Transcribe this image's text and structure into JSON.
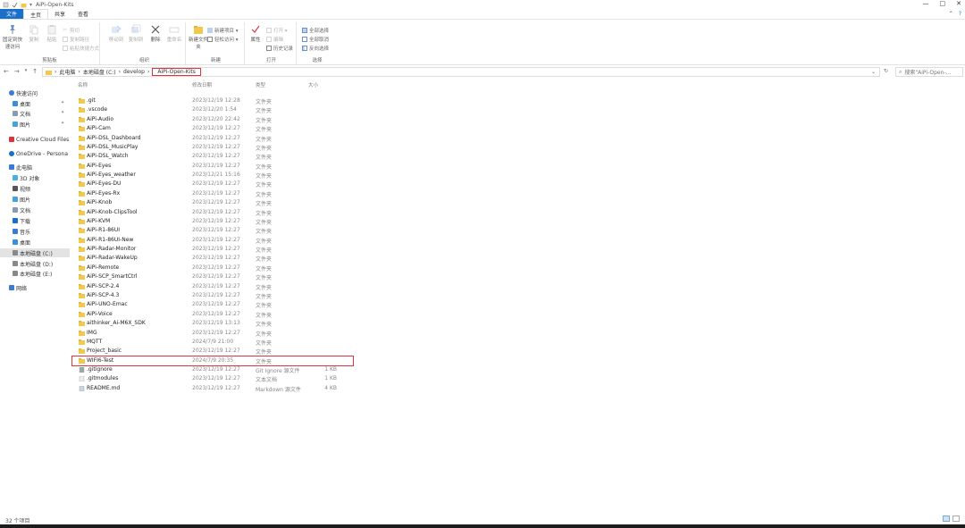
{
  "window": {
    "title": "AiPi-Open-Kits",
    "controls": [
      "—",
      "□",
      "✕"
    ]
  },
  "ribbon_tabs": [
    {
      "label": "文件"
    },
    {
      "label": "主页"
    },
    {
      "label": "共享"
    },
    {
      "label": "查看"
    }
  ],
  "ribbon": {
    "clipboard": {
      "group_label": "剪贴板",
      "pin_label": "固定到快速访问",
      "copy_label": "复制",
      "paste_label": "粘贴",
      "cut_label": "剪切",
      "copy_path_label": "复制路径",
      "paste_shortcut_label": "粘贴快捷方式"
    },
    "organize": {
      "group_label": "组织",
      "move_to_label": "移动到",
      "copy_to_label": "复制到",
      "delete_label": "删除",
      "rename_label": "重命名"
    },
    "new": {
      "group_label": "新建",
      "new_folder_label": "新建文件夹",
      "new_item_label": "新建项目 ▾",
      "easy_access_label": "轻松访问 ▾"
    },
    "open": {
      "group_label": "打开",
      "properties_label": "属性",
      "open_label": "打开 ▾",
      "edit_label": "编辑",
      "history_label": "历史记录"
    },
    "select": {
      "group_label": "选择",
      "select_all_label": "全部选择",
      "select_none_label": "全部取消",
      "invert_label": "反向选择"
    }
  },
  "address": {
    "crumbs": [
      "此电脑",
      "本地磁盘 (C:)",
      "develop",
      "AiPi-Open-Kits"
    ],
    "separator": "›",
    "search_placeholder": "搜索\"AiPi-Open-..."
  },
  "sidebar": {
    "items": [
      {
        "label": "快速访问",
        "icon": "star-icon"
      },
      {
        "label": "桌面",
        "icon": "desktop-icon"
      },
      {
        "label": "文档",
        "icon": "documents-icon"
      },
      {
        "label": "图片",
        "icon": "pictures-icon"
      },
      {
        "label": "Creative Cloud Files",
        "icon": "creative-cloud-icon"
      },
      {
        "label": "OneDrive - Persona",
        "icon": "onedrive-icon"
      },
      {
        "label": "此电脑",
        "icon": "pc-icon"
      },
      {
        "label": "3D 对象",
        "icon": "3d-objects-icon"
      },
      {
        "label": "视频",
        "icon": "videos-icon"
      },
      {
        "label": "图片",
        "icon": "pictures-icon"
      },
      {
        "label": "文档",
        "icon": "documents-icon"
      },
      {
        "label": "下载",
        "icon": "downloads-icon"
      },
      {
        "label": "音乐",
        "icon": "music-icon"
      },
      {
        "label": "桌面",
        "icon": "desktop-icon"
      },
      {
        "label": "本地磁盘 (C:)",
        "icon": "drive-icon"
      },
      {
        "label": "本地磁盘 (D:)",
        "icon": "drive-icon"
      },
      {
        "label": "本地磁盘 (E:)",
        "icon": "drive-icon"
      },
      {
        "label": "网络",
        "icon": "network-icon"
      }
    ]
  },
  "columns": {
    "name": "名称",
    "date": "修改日期",
    "type": "类型",
    "size": "大小"
  },
  "files": [
    {
      "name": ".git",
      "date": "2023/12/19 12:28",
      "type": "文件夹",
      "size": "",
      "kind": "folder"
    },
    {
      "name": ".vscode",
      "date": "2023/12/20 1:54",
      "type": "文件夹",
      "size": "",
      "kind": "folder"
    },
    {
      "name": "AiPi-Audio",
      "date": "2023/12/20 22:42",
      "type": "文件夹",
      "size": "",
      "kind": "folder"
    },
    {
      "name": "AiPi-Cam",
      "date": "2023/12/19 12:27",
      "type": "文件夹",
      "size": "",
      "kind": "folder"
    },
    {
      "name": "AiPi-DSL_Dashboard",
      "date": "2023/12/19 12:27",
      "type": "文件夹",
      "size": "",
      "kind": "folder"
    },
    {
      "name": "AiPi-DSL_MusicPlay",
      "date": "2023/12/19 12:27",
      "type": "文件夹",
      "size": "",
      "kind": "folder"
    },
    {
      "name": "AiPi-DSL_Watch",
      "date": "2023/12/19 12:27",
      "type": "文件夹",
      "size": "",
      "kind": "folder"
    },
    {
      "name": "AiPi-Eyes",
      "date": "2023/12/19 12:27",
      "type": "文件夹",
      "size": "",
      "kind": "folder"
    },
    {
      "name": "AiPi-Eyes_weather",
      "date": "2023/12/21 15:16",
      "type": "文件夹",
      "size": "",
      "kind": "folder"
    },
    {
      "name": "AiPi-Eyes-DU",
      "date": "2023/12/19 12:27",
      "type": "文件夹",
      "size": "",
      "kind": "folder"
    },
    {
      "name": "AiPi-Eyes-Rx",
      "date": "2023/12/19 12:27",
      "type": "文件夹",
      "size": "",
      "kind": "folder"
    },
    {
      "name": "AiPi-Knob",
      "date": "2023/12/19 12:27",
      "type": "文件夹",
      "size": "",
      "kind": "folder"
    },
    {
      "name": "AiPi-Knob-ClipsTool",
      "date": "2023/12/19 12:27",
      "type": "文件夹",
      "size": "",
      "kind": "folder"
    },
    {
      "name": "AiPi-KVM",
      "date": "2023/12/19 12:27",
      "type": "文件夹",
      "size": "",
      "kind": "folder"
    },
    {
      "name": "AiPi-R1-86UI",
      "date": "2023/12/19 12:27",
      "type": "文件夹",
      "size": "",
      "kind": "folder"
    },
    {
      "name": "AiPi-R1-86UI-New",
      "date": "2023/12/19 12:27",
      "type": "文件夹",
      "size": "",
      "kind": "folder"
    },
    {
      "name": "AiPi-Radar-Monitor",
      "date": "2023/12/19 12:27",
      "type": "文件夹",
      "size": "",
      "kind": "folder"
    },
    {
      "name": "AiPi-Radar-WakeUp",
      "date": "2023/12/19 12:27",
      "type": "文件夹",
      "size": "",
      "kind": "folder"
    },
    {
      "name": "AiPi-Remote",
      "date": "2023/12/19 12:27",
      "type": "文件夹",
      "size": "",
      "kind": "folder"
    },
    {
      "name": "AiPi-SCP_SmartCtrl",
      "date": "2023/12/19 12:27",
      "type": "文件夹",
      "size": "",
      "kind": "folder"
    },
    {
      "name": "AiPi-SCP-2.4",
      "date": "2023/12/19 12:27",
      "type": "文件夹",
      "size": "",
      "kind": "folder"
    },
    {
      "name": "AiPi-SCP-4.3",
      "date": "2023/12/19 12:27",
      "type": "文件夹",
      "size": "",
      "kind": "folder"
    },
    {
      "name": "AiPi-UNO-Emac",
      "date": "2023/12/19 12:27",
      "type": "文件夹",
      "size": "",
      "kind": "folder"
    },
    {
      "name": "AiPi-Voice",
      "date": "2023/12/19 12:27",
      "type": "文件夹",
      "size": "",
      "kind": "folder"
    },
    {
      "name": "aithinker_Ai-M6X_SDK",
      "date": "2023/12/19 13:13",
      "type": "文件夹",
      "size": "",
      "kind": "folder"
    },
    {
      "name": "IMG",
      "date": "2023/12/19 12:27",
      "type": "文件夹",
      "size": "",
      "kind": "folder"
    },
    {
      "name": "MQTT",
      "date": "2024/7/9 21:00",
      "type": "文件夹",
      "size": "",
      "kind": "folder"
    },
    {
      "name": "Project_basic",
      "date": "2023/12/19 12:27",
      "type": "文件夹",
      "size": "",
      "kind": "folder"
    },
    {
      "name": "WIFI6-Test",
      "date": "2024/7/9 20:35",
      "type": "文件夹",
      "size": "",
      "kind": "folder",
      "highlighted": true
    },
    {
      "name": ".gitignore",
      "date": "2023/12/19 12:27",
      "type": "Git Ignore 源文件",
      "size": "1 KB",
      "kind": "gitfile"
    },
    {
      "name": ".gitmodules",
      "date": "2023/12/19 12:27",
      "type": "文本文档",
      "size": "1 KB",
      "kind": "textfile"
    },
    {
      "name": "README.md",
      "date": "2023/12/19 12:27",
      "type": "Markdown 源文件",
      "size": "4 KB",
      "kind": "mdfile"
    }
  ],
  "status": {
    "count_text": "32 个项目"
  },
  "colors": {
    "folder": "#f2c94c",
    "accent": "#1a6fc9",
    "highlight_box": "#d9363e"
  }
}
